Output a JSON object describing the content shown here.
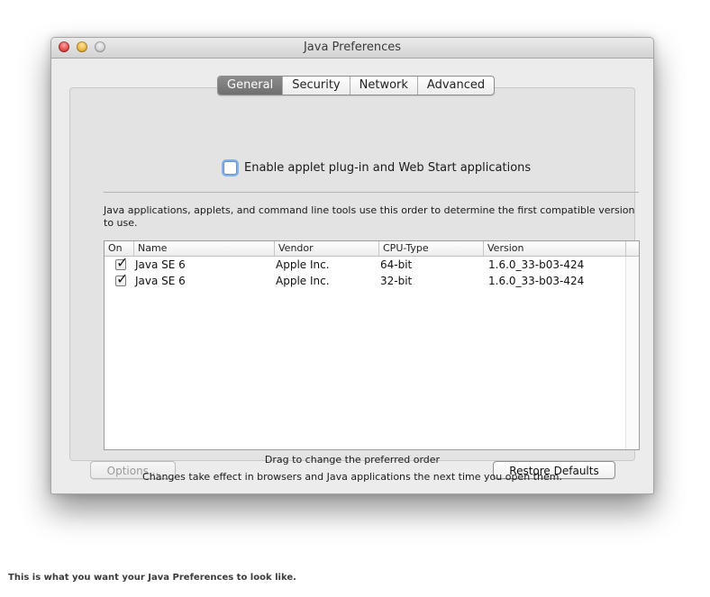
{
  "window": {
    "title": "Java Preferences"
  },
  "tabs": [
    {
      "label": "General",
      "active": true
    },
    {
      "label": "Security",
      "active": false
    },
    {
      "label": "Network",
      "active": false
    },
    {
      "label": "Advanced",
      "active": false
    }
  ],
  "general": {
    "enable_checkbox_label": "Enable applet plug-in and Web Start applications",
    "enable_checked": false,
    "description": "Java applications, applets, and command line tools use this order to determine the first compatible version to use.",
    "table": {
      "columns": [
        "On",
        "Name",
        "Vendor",
        "CPU-Type",
        "Version"
      ],
      "rows": [
        {
          "on": true,
          "name": "Java SE 6",
          "vendor": "Apple Inc.",
          "cpu": "64-bit",
          "version": "1.6.0_33-b03-424"
        },
        {
          "on": true,
          "name": "Java SE 6",
          "vendor": "Apple Inc.",
          "cpu": "32-bit",
          "version": "1.6.0_33-b03-424"
        }
      ]
    },
    "drag_hint": "Drag to change the preferred order",
    "options_label": "Options...",
    "restore_label": "Restore Defaults"
  },
  "footer_note": "Changes take effect in browsers and Java applications the next time you open them.",
  "caption": "This is what you want your Java Preferences to look like.",
  "icons": {
    "check": "✓"
  }
}
